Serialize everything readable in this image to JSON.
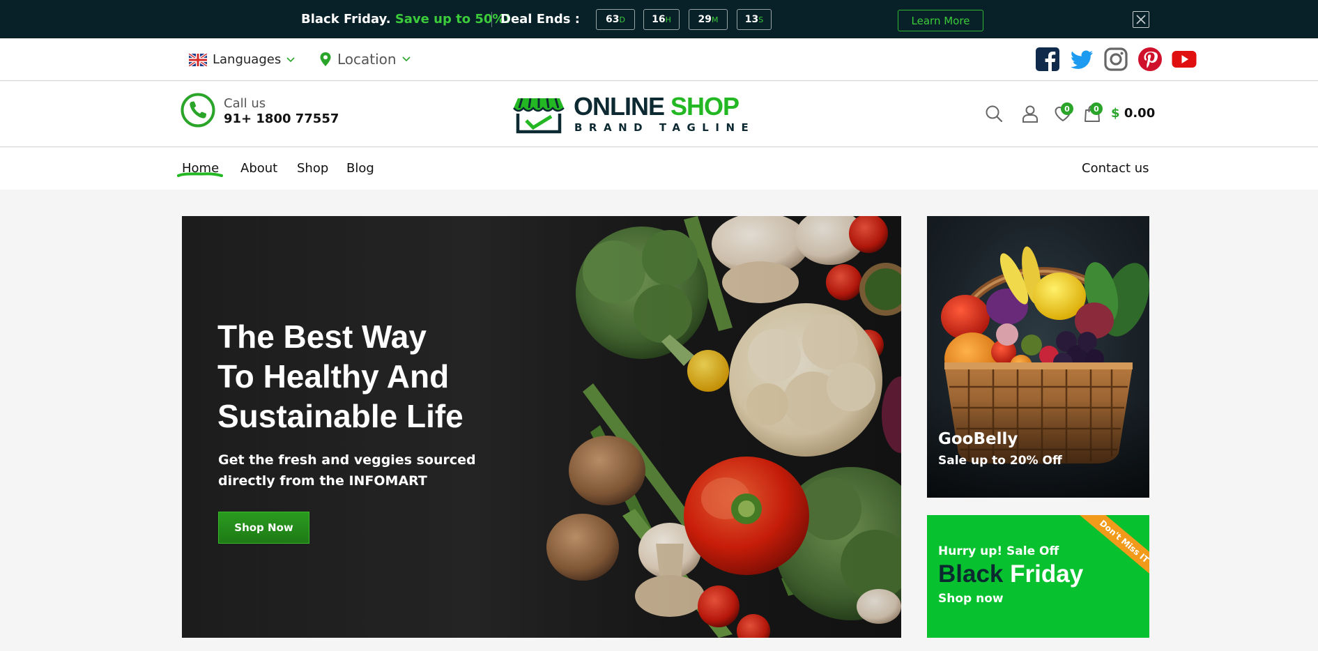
{
  "promo": {
    "headline": "Black Friday.",
    "highlight": "Save up to 50%!",
    "deal_label": "Deal Ends :",
    "countdown": [
      {
        "value": "63",
        "unit": "D"
      },
      {
        "value": "16",
        "unit": "H"
      },
      {
        "value": "29",
        "unit": "M"
      },
      {
        "value": "13",
        "unit": "S"
      }
    ],
    "learn_more": "Learn More"
  },
  "utility": {
    "language_label": "Languages",
    "location_label": "Location",
    "socials": [
      "facebook-icon",
      "twitter-icon",
      "instagram-icon",
      "pinterest-icon",
      "youtube-icon"
    ]
  },
  "header": {
    "call_label": "Call us",
    "call_number": "91+ 1800 77557",
    "logo_word1": "ONLINE",
    "logo_word2": "SHOP",
    "tagline": "BRAND TAGLINE",
    "wishlist_count": "0",
    "cart_count": "0",
    "currency": "$",
    "cart_total": "0.00"
  },
  "nav": {
    "items": [
      "Home",
      "About",
      "Shop",
      "Blog"
    ],
    "contact": "Contact us",
    "active": "Home"
  },
  "hero": {
    "title_lines": [
      "The Best Way",
      "To Healthy And",
      "Sustainable Life"
    ],
    "subtitle_lines": [
      "Get the fresh and veggies sourced",
      "directly from the INFOMART"
    ],
    "cta": "Shop Now"
  },
  "cards": {
    "basket": {
      "title": "GooBelly",
      "subtitle": "Sale up to 20% Off"
    },
    "black_friday": {
      "ribbon": "Don't Miss IT",
      "hurry": "Hurry up! Sale Off",
      "title_dark": "Black",
      "title_light": "Friday",
      "cta": "Shop now"
    }
  },
  "colors": {
    "accent_green": "#23b823",
    "promo_bg": "#082128",
    "brand_dark": "#0d2a33",
    "ribbon_orange": "#f29a1a"
  }
}
